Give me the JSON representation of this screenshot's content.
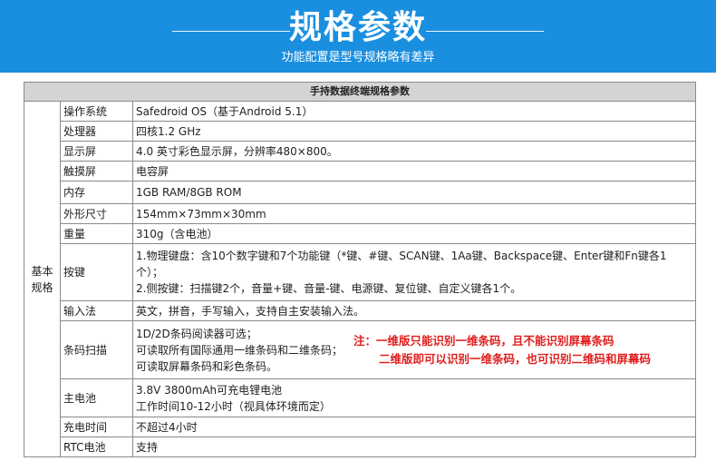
{
  "banner": {
    "title": "规格参数",
    "subtitle": "功能配置是型号规格略有差异"
  },
  "table": {
    "header": "手持数据终端规格参数",
    "category": "基本\n规格",
    "rows": [
      {
        "name": "操作系统",
        "value": "Safedroid OS（基于Android 5.1）"
      },
      {
        "name": "处理器",
        "value": "四核1.2 GHz"
      },
      {
        "name": "显示屏",
        "value": "4.0 英寸彩色显示屏，分辨率480×800。"
      },
      {
        "name": "触摸屏",
        "value": "电容屏"
      },
      {
        "name": "内存",
        "value": "1GB RAM/8GB ROM"
      },
      {
        "name": "外形尺寸",
        "value": "154mm×73mm×30mm"
      },
      {
        "name": "重量",
        "value": "310g（含电池）"
      },
      {
        "name": "按键",
        "lines": [
          "1.物理键盘：含10个数字键和7个功能键（*键、#键、SCAN键、1Aa键、Backspace键、Enter键和Fn键各1",
          "个）；",
          "2.侧按键：扫描键2个，音量+键、音量-键、电源键、复位键、自定义键各1个。"
        ]
      },
      {
        "name": "输入法",
        "value": "英文，拼音，手写输入，支持自主安装输入法。"
      },
      {
        "name": "条码扫描",
        "lines": [
          "1D/2D条码阅读器可选；",
          "可读取所有国际通用一维条码和二维条码；",
          "可读取屏幕条码和彩色条码。"
        ],
        "note": [
          "注：一维版只能识别一维条码，且不能识别屏幕条码",
          "二维版即可以识别一维条码，也可识别二维码和屏幕码"
        ]
      },
      {
        "name": "主电池",
        "lines": [
          "3.8V 3800mAh可充电锂电池",
          "工作时间10-12小时（视具体环境而定）"
        ]
      },
      {
        "name": "充电时间",
        "value": "不超过4小时"
      },
      {
        "name": "RTC电池",
        "value": "支持"
      }
    ]
  },
  "colors": {
    "banner": "#1a8fe0",
    "header_bg": "#d4d4d4",
    "note": "#e01e1e",
    "border": "#8a8a8a"
  }
}
